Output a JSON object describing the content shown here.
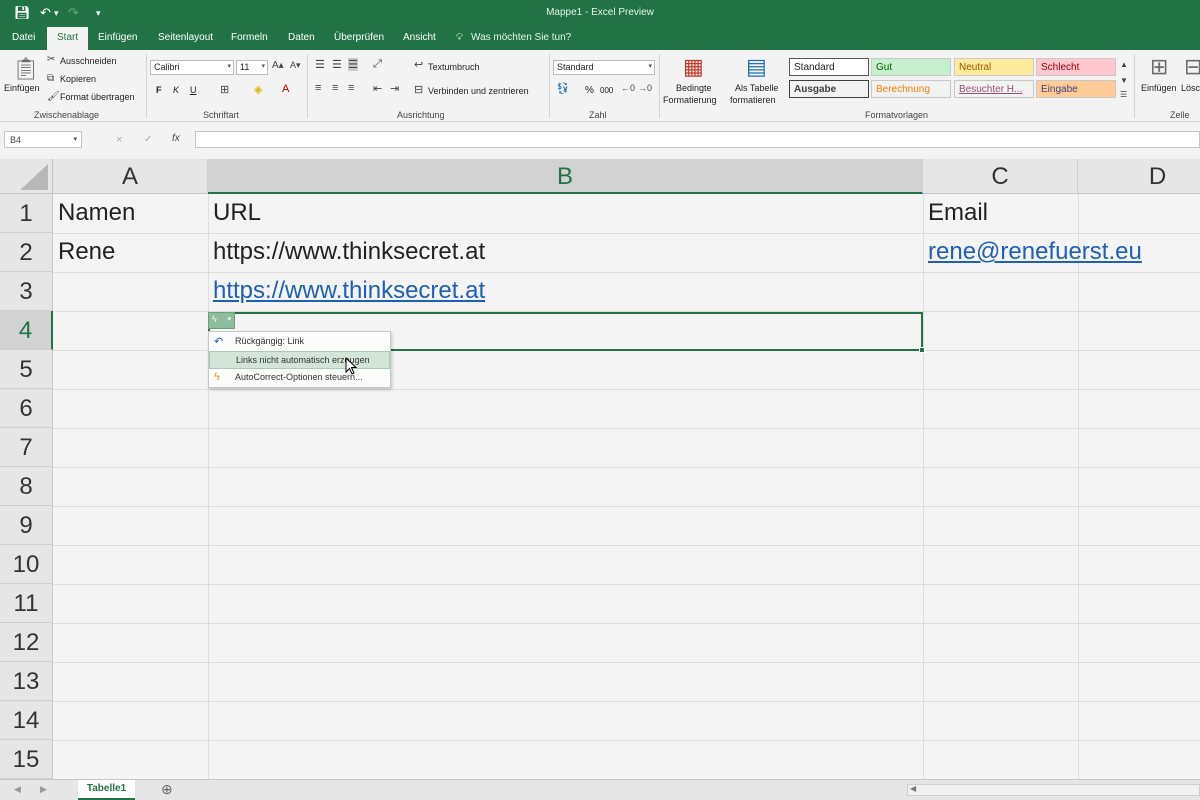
{
  "window": {
    "title": "Mappe1  -  Excel Preview"
  },
  "qat": {
    "save_icon": "save-icon",
    "undo_icon": "undo-icon",
    "redo_icon": "redo-icon",
    "more_icon": "customize-icon"
  },
  "tabs": [
    "Datei",
    "Start",
    "Einfügen",
    "Seitenlayout",
    "Formeln",
    "Daten",
    "Überprüfen",
    "Ansicht"
  ],
  "tellme": "Was möchten Sie tun?",
  "ribbon": {
    "clipboard": {
      "paste": "Einfügen",
      "cut": "Ausschneiden",
      "copy": "Kopieren",
      "format_painter": "Format übertragen",
      "label": "Zwischenablage"
    },
    "font": {
      "name": "Calibri",
      "size": "11",
      "bold": "F",
      "italic": "K",
      "underline": "U",
      "label": "Schriftart"
    },
    "alignment": {
      "wrap": "Textumbruch",
      "merge": "Verbinden und zentrieren",
      "label": "Ausrichtung"
    },
    "number": {
      "format": "Standard",
      "percent": "%",
      "thousands": "000",
      "label": "Zahl"
    },
    "styles": {
      "conditional": [
        "Bedingte",
        "Formatierung"
      ],
      "as_table": [
        "Als Tabelle",
        "formatieren"
      ],
      "items": [
        {
          "label": "Standard",
          "bg": "#ffffff",
          "fg": "#222222"
        },
        {
          "label": "Gut",
          "bg": "#c6efce",
          "fg": "#006100"
        },
        {
          "label": "Neutral",
          "bg": "#ffeb9c",
          "fg": "#9c5700"
        },
        {
          "label": "Schlecht",
          "bg": "#ffc7ce",
          "fg": "#9c0006"
        },
        {
          "label": "Ausgabe",
          "bg": "#f2f2f2",
          "fg": "#3f3f3f"
        },
        {
          "label": "Berechnung",
          "bg": "#f2f2f2",
          "fg": "#fa7d00"
        },
        {
          "label": "Besuchter H...",
          "bg": "#f3f3f3",
          "fg": "#954f72"
        },
        {
          "label": "Eingabe",
          "bg": "#ffcc99",
          "fg": "#3f3f76"
        }
      ],
      "label": "Formatvorlagen"
    },
    "cells": {
      "insert": "Einfügen",
      "delete": "Lösc",
      "label": "Zelle"
    }
  },
  "formula_bar": {
    "name_box": "B4",
    "cancel": "×",
    "enter": "✓",
    "fx": "fx",
    "value": ""
  },
  "sheet": {
    "columns": [
      "A",
      "B",
      "C",
      "D"
    ],
    "rows": [
      "1",
      "2",
      "3",
      "4",
      "5",
      "6",
      "7",
      "8",
      "9",
      "10",
      "11",
      "12",
      "13",
      "14",
      "15"
    ],
    "cells": {
      "A1": "Namen",
      "B1": "URL",
      "C1": "Email",
      "A2": "Rene",
      "B2": "https://www.thinksecret.at",
      "C2": "rene@renefuerst.eu",
      "B3": "https://www.thinksecret.at"
    },
    "selected": "B4"
  },
  "autocorrect_menu": {
    "button_icon": "autocorrect-lightning-icon",
    "items": [
      {
        "label": "Rückgängig: Link",
        "icon": "undo-icon"
      },
      {
        "label": "Links nicht automatisch erzeugen",
        "icon": ""
      },
      {
        "label": "AutoCorrect-Optionen steuern...",
        "icon": "autocorrect-icon"
      }
    ]
  },
  "sheet_tabs": [
    "Tabelle1"
  ],
  "colors": {
    "accent": "#217346",
    "link": "#1f5fb4"
  }
}
